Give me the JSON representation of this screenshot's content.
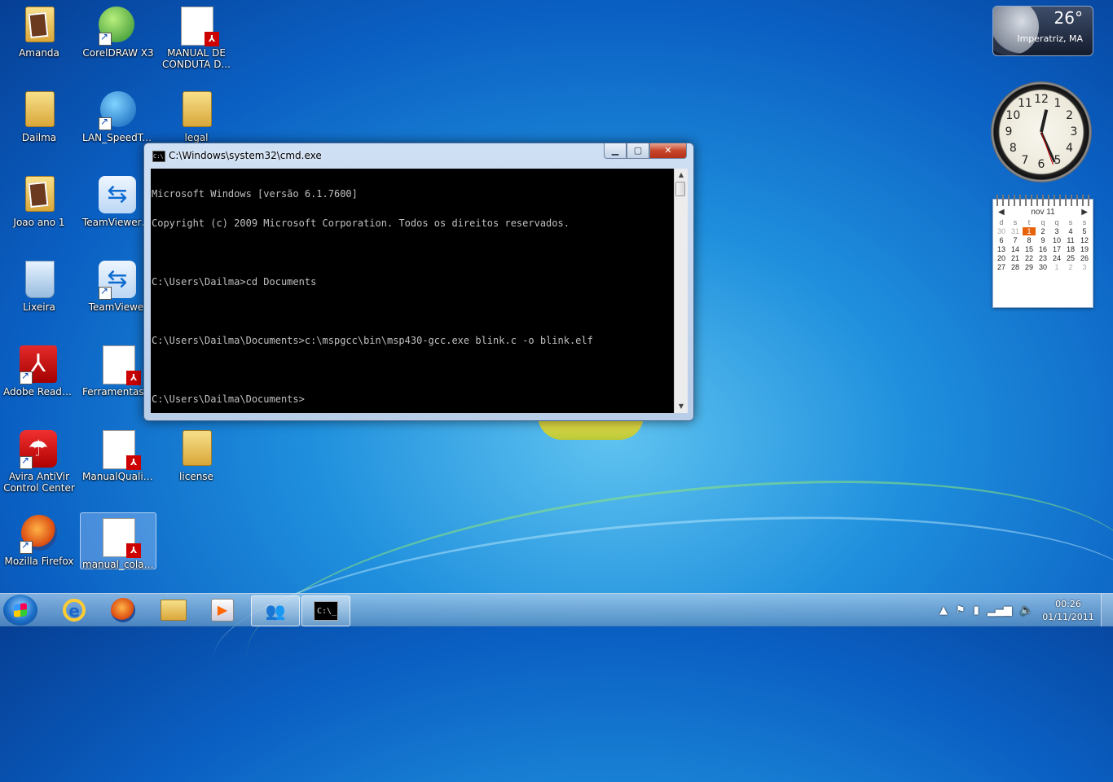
{
  "desktop": {
    "icons": [
      {
        "label": "Amanda"
      },
      {
        "label": "CorelDRAW X3"
      },
      {
        "label": "MANUAL DE CONDUTA D..."
      },
      {
        "label": "Dailma"
      },
      {
        "label": "LAN_SpeedTest"
      },
      {
        "label": "legal"
      },
      {
        "label": "Joao ano 1"
      },
      {
        "label": "TeamViewer_S..."
      },
      {
        "label": "Lixeira"
      },
      {
        "label": "TeamViewer"
      },
      {
        "label": "Adobe Reader 9"
      },
      {
        "label": "FerramentasD..."
      },
      {
        "label": "Avira AntiVir Control Center"
      },
      {
        "label": "ManualQualid..."
      },
      {
        "label": "license"
      },
      {
        "label": "Mozilla Firefox"
      },
      {
        "label": "manual_colabo..."
      }
    ]
  },
  "cmd_window": {
    "title": "C:\\Windows\\system32\\cmd.exe",
    "icon_text": "C:\\",
    "lines": [
      "Microsoft Windows [versão 6.1.7600]",
      "Copyright (c) 2009 Microsoft Corporation. Todos os direitos reservados.",
      "",
      "C:\\Users\\Dailma>cd Documents",
      "",
      "C:\\Users\\Dailma\\Documents>c:\\mspgcc\\bin\\msp430-gcc.exe blink.c -o blink.elf",
      "",
      "C:\\Users\\Dailma\\Documents>"
    ],
    "buttons": {
      "minimize": "▁",
      "maximize": "▢",
      "close": "✕"
    }
  },
  "weather_gadget": {
    "temperature": "26°",
    "city": "Imperatriz, MA"
  },
  "clock_gadget": {
    "numbers": [
      "12",
      "1",
      "2",
      "3",
      "4",
      "5",
      "6",
      "7",
      "8",
      "9",
      "10",
      "11"
    ],
    "hour": 12,
    "minute": 26
  },
  "calendar_gadget": {
    "month": "nov 11",
    "prev": "◀",
    "next": "▶",
    "weekdays": [
      "d",
      "s",
      "t",
      "q",
      "q",
      "s",
      "s"
    ],
    "days": [
      {
        "d": "30",
        "dim": true
      },
      {
        "d": "31",
        "dim": true
      },
      {
        "d": "1",
        "today": true
      },
      {
        "d": "2"
      },
      {
        "d": "3"
      },
      {
        "d": "4"
      },
      {
        "d": "5"
      },
      {
        "d": "6"
      },
      {
        "d": "7"
      },
      {
        "d": "8"
      },
      {
        "d": "9"
      },
      {
        "d": "10"
      },
      {
        "d": "11"
      },
      {
        "d": "12"
      },
      {
        "d": "13"
      },
      {
        "d": "14"
      },
      {
        "d": "15"
      },
      {
        "d": "16"
      },
      {
        "d": "17"
      },
      {
        "d": "18"
      },
      {
        "d": "19"
      },
      {
        "d": "20"
      },
      {
        "d": "21"
      },
      {
        "d": "22"
      },
      {
        "d": "23"
      },
      {
        "d": "24"
      },
      {
        "d": "25"
      },
      {
        "d": "26"
      },
      {
        "d": "27"
      },
      {
        "d": "28"
      },
      {
        "d": "29"
      },
      {
        "d": "30"
      },
      {
        "d": "1",
        "dim": true
      },
      {
        "d": "2",
        "dim": true
      },
      {
        "d": "3",
        "dim": true
      }
    ]
  },
  "taskbar": {
    "time": "00:26",
    "date": "01/11/2011",
    "tray_icons": [
      "▲",
      "⚑",
      "▮",
      "▂▄▆",
      "🔈"
    ],
    "cmd_icon_text": "C:\\_"
  }
}
